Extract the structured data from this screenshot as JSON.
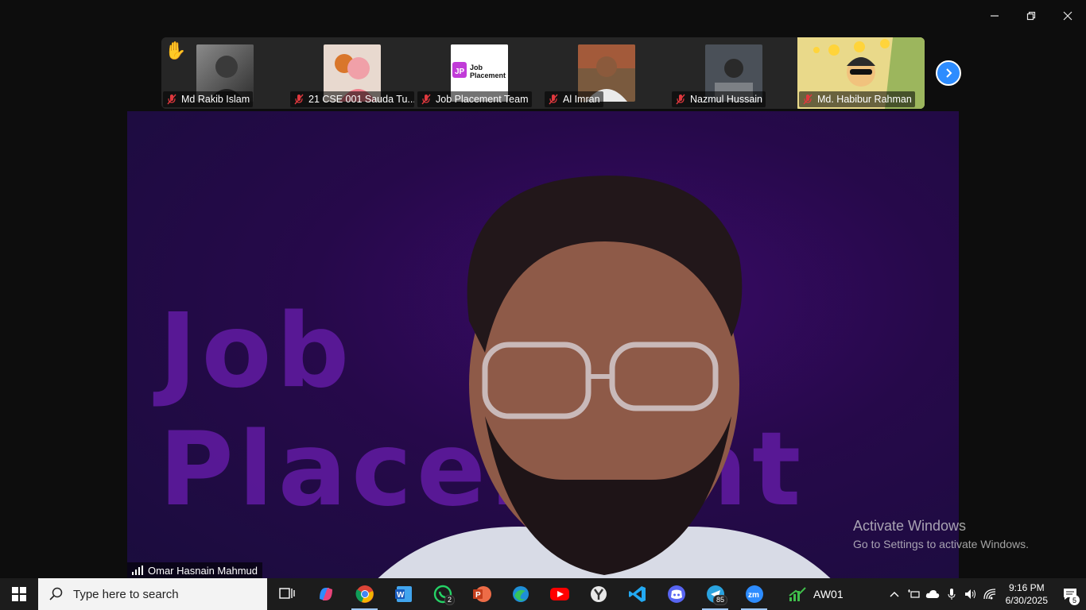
{
  "window": {
    "minimize_icon": "minimize-icon",
    "restore_icon": "restore-icon",
    "close_icon": "close-icon"
  },
  "participants": [
    {
      "name": "Md Rakib Islam",
      "muted": true,
      "hand_raised": true
    },
    {
      "name": "21 CSE 001 Sauda Tu...",
      "muted": true
    },
    {
      "name": "Job Placement Team",
      "muted": true,
      "logo_text": "Job Placement"
    },
    {
      "name": "Al Imran",
      "muted": true
    },
    {
      "name": "Nazmul Hussain",
      "muted": true
    },
    {
      "name": "Md. Habibur Rahman",
      "muted": true,
      "active": true
    }
  ],
  "main_video": {
    "background_text": "Job Placement",
    "speaker_name": "Omar Hasnain Mahmud"
  },
  "watermark": {
    "title": "Activate Windows",
    "subtitle": "Go to Settings to activate Windows."
  },
  "taskbar": {
    "search_placeholder": "Type here to search",
    "apps": [
      {
        "name": "task-view"
      },
      {
        "name": "copilot"
      },
      {
        "name": "chrome",
        "running": true
      },
      {
        "name": "word"
      },
      {
        "name": "whatsapp",
        "badge": "2"
      },
      {
        "name": "powerpoint"
      },
      {
        "name": "edge"
      },
      {
        "name": "youtube"
      },
      {
        "name": "y-app"
      },
      {
        "name": "vscode"
      },
      {
        "name": "discord"
      },
      {
        "name": "telegram",
        "badge": "85",
        "running": true
      },
      {
        "name": "zoom",
        "running": true
      }
    ],
    "widget_label": "AW01",
    "time": "9:16 PM",
    "date": "6/30/2025",
    "notification_count": "5"
  },
  "colors": {
    "accent_blue": "#2d8cff",
    "mute_red": "#e0383e",
    "video_purple": "#2a0a52"
  }
}
